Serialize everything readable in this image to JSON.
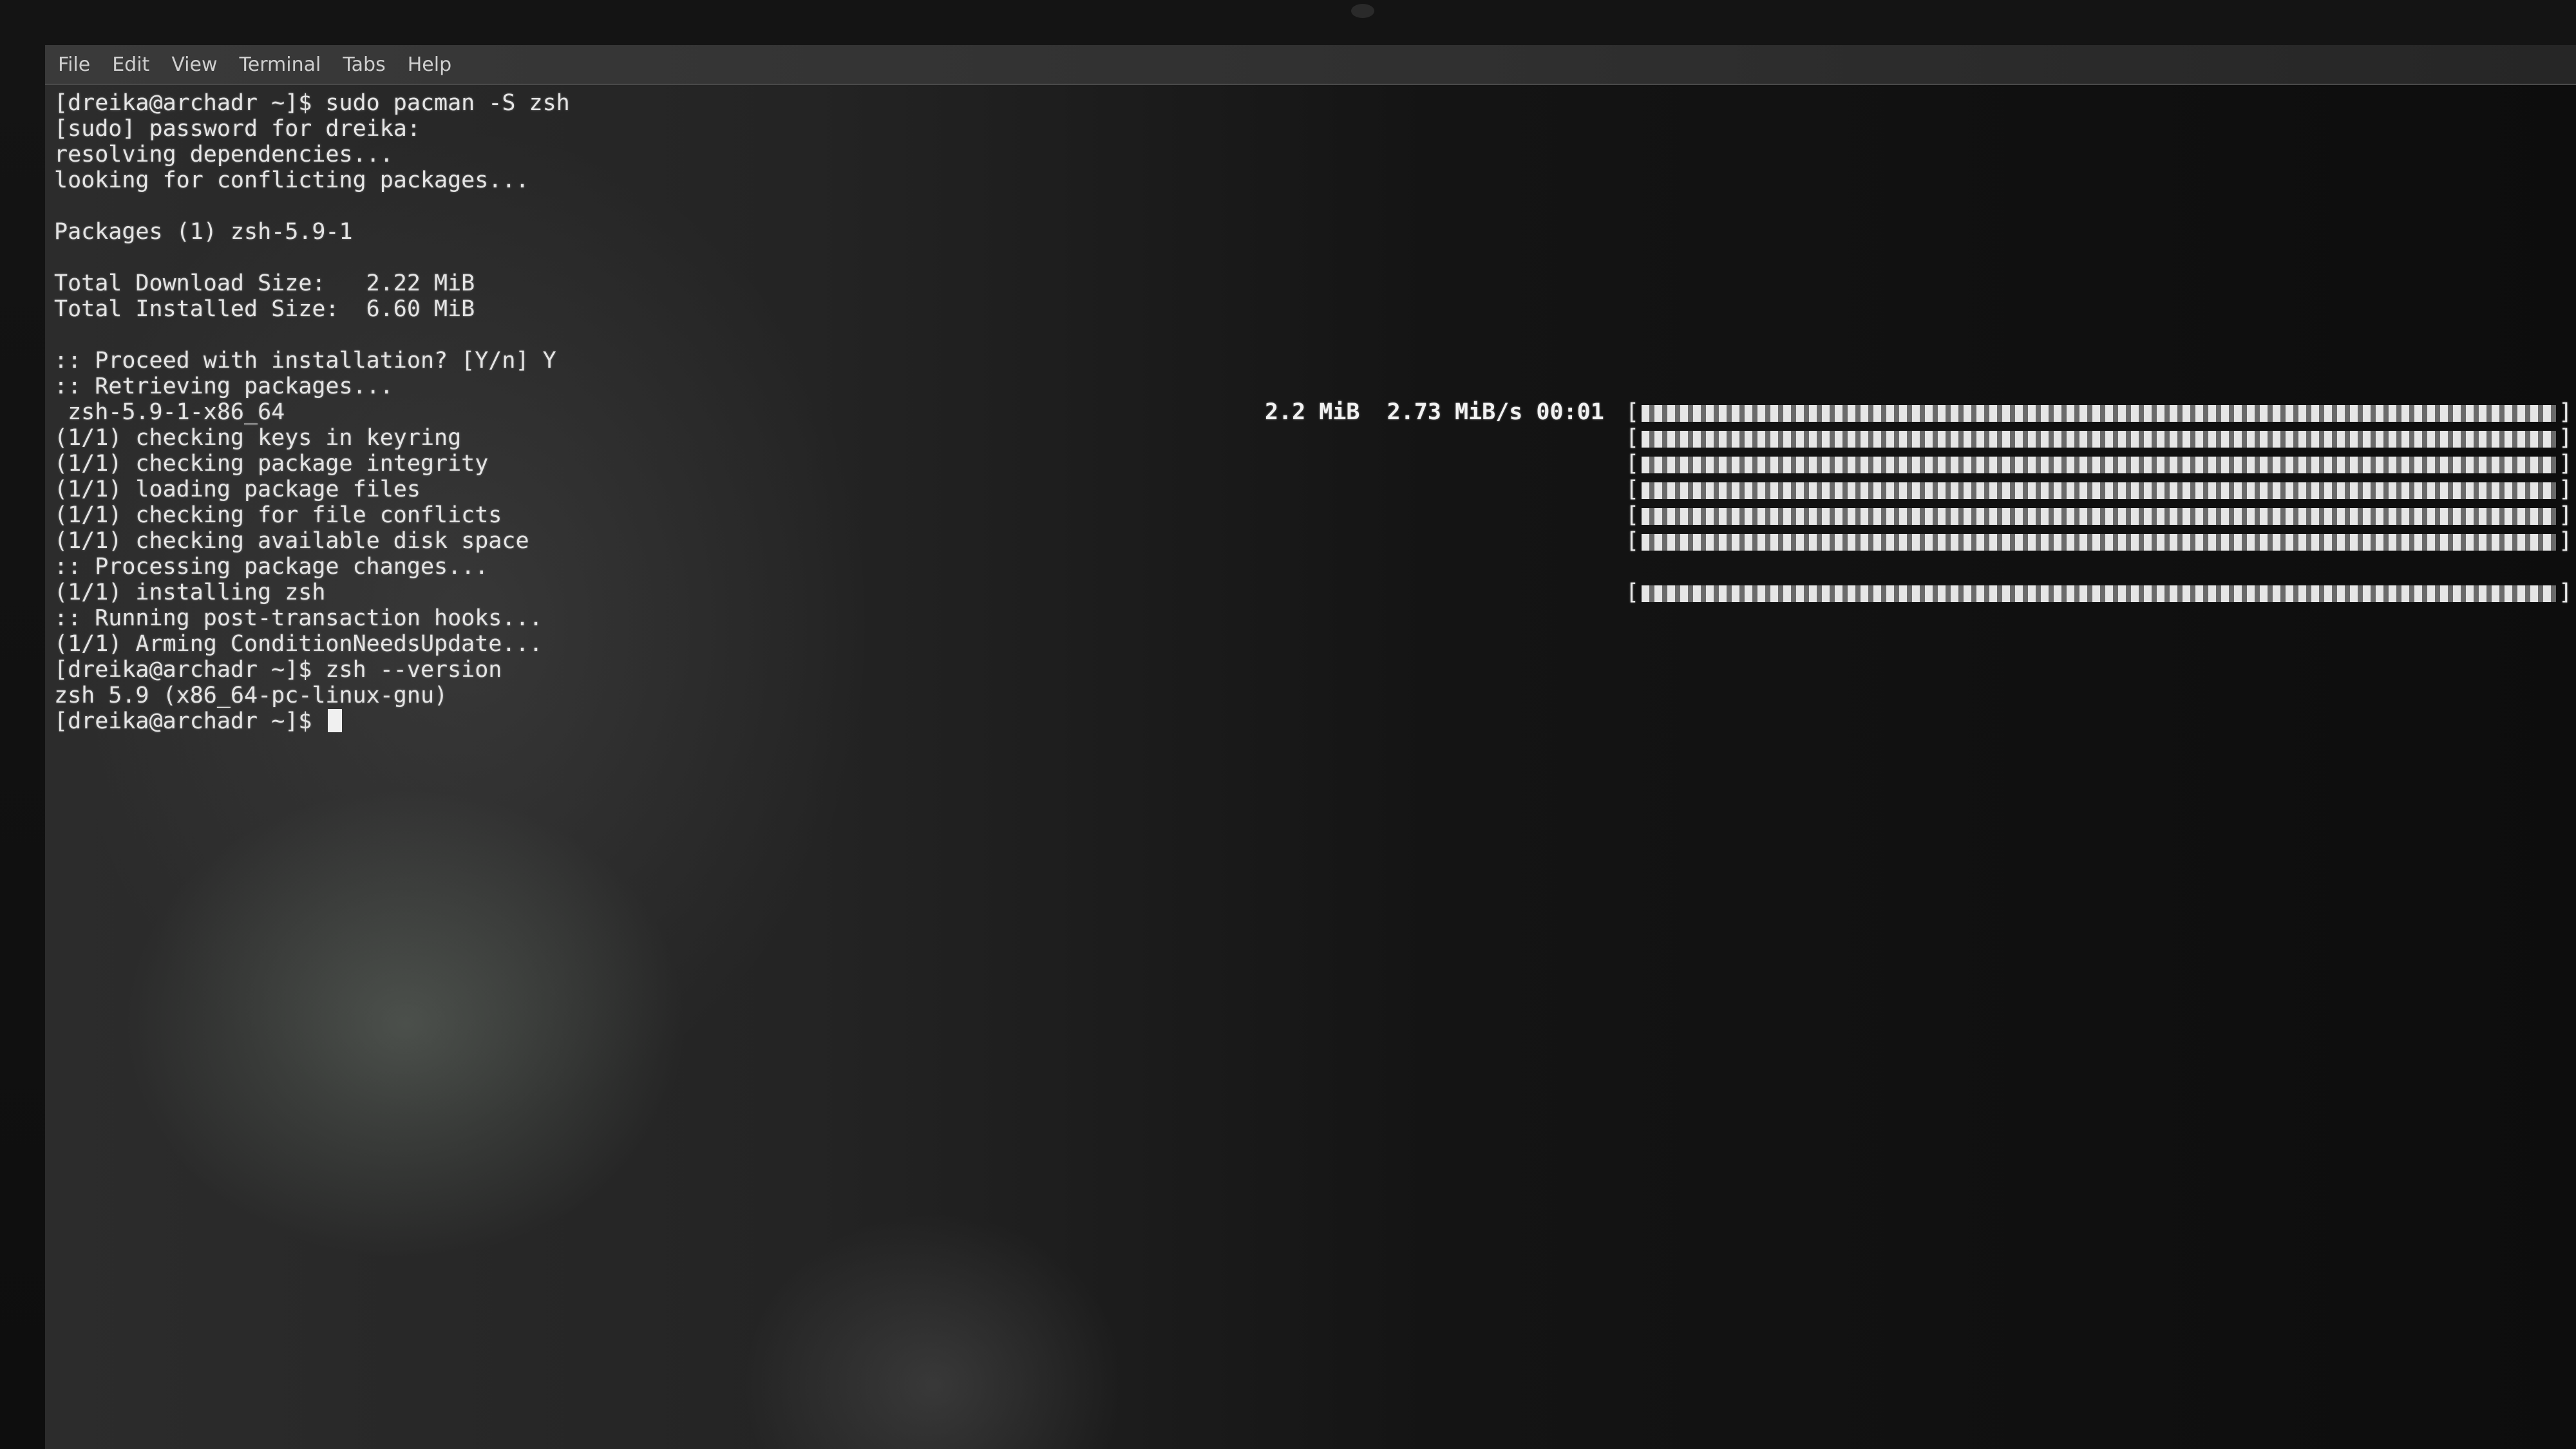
{
  "menubar": {
    "items": [
      "File",
      "Edit",
      "View",
      "Terminal",
      "Tabs",
      "Help"
    ]
  },
  "terminal": {
    "lines": [
      "[dreika@archadr ~]$ sudo pacman -S zsh",
      "[sudo] password for dreika:",
      "resolving dependencies...",
      "looking for conflicting packages...",
      "",
      "Packages (1) zsh-5.9-1",
      "",
      "Total Download Size:   2.22 MiB",
      "Total Installed Size:  6.60 MiB",
      "",
      ":: Proceed with installation? [Y/n] Y",
      ":: Retrieving packages...",
      " zsh-5.9-1-x86_64",
      "(1/1) checking keys in keyring",
      "(1/1) checking package integrity",
      "(1/1) loading package files",
      "(1/1) checking for file conflicts",
      "(1/1) checking available disk space",
      ":: Processing package changes...",
      "(1/1) installing zsh",
      ":: Running post-transaction hooks...",
      "(1/1) Arming ConditionNeedsUpdate...",
      "[dreika@archadr ~]$ zsh --version",
      "zsh 5.9 (x86_64-pc-linux-gnu)",
      "[dreika@archadr ~]$ "
    ],
    "download_stats": "2.2 MiB  2.73 MiB/s 00:01",
    "progress_fraction": 1.0
  },
  "colors": {
    "text": "#e4e4e4",
    "menubar": "#333333",
    "background": "#121212"
  }
}
